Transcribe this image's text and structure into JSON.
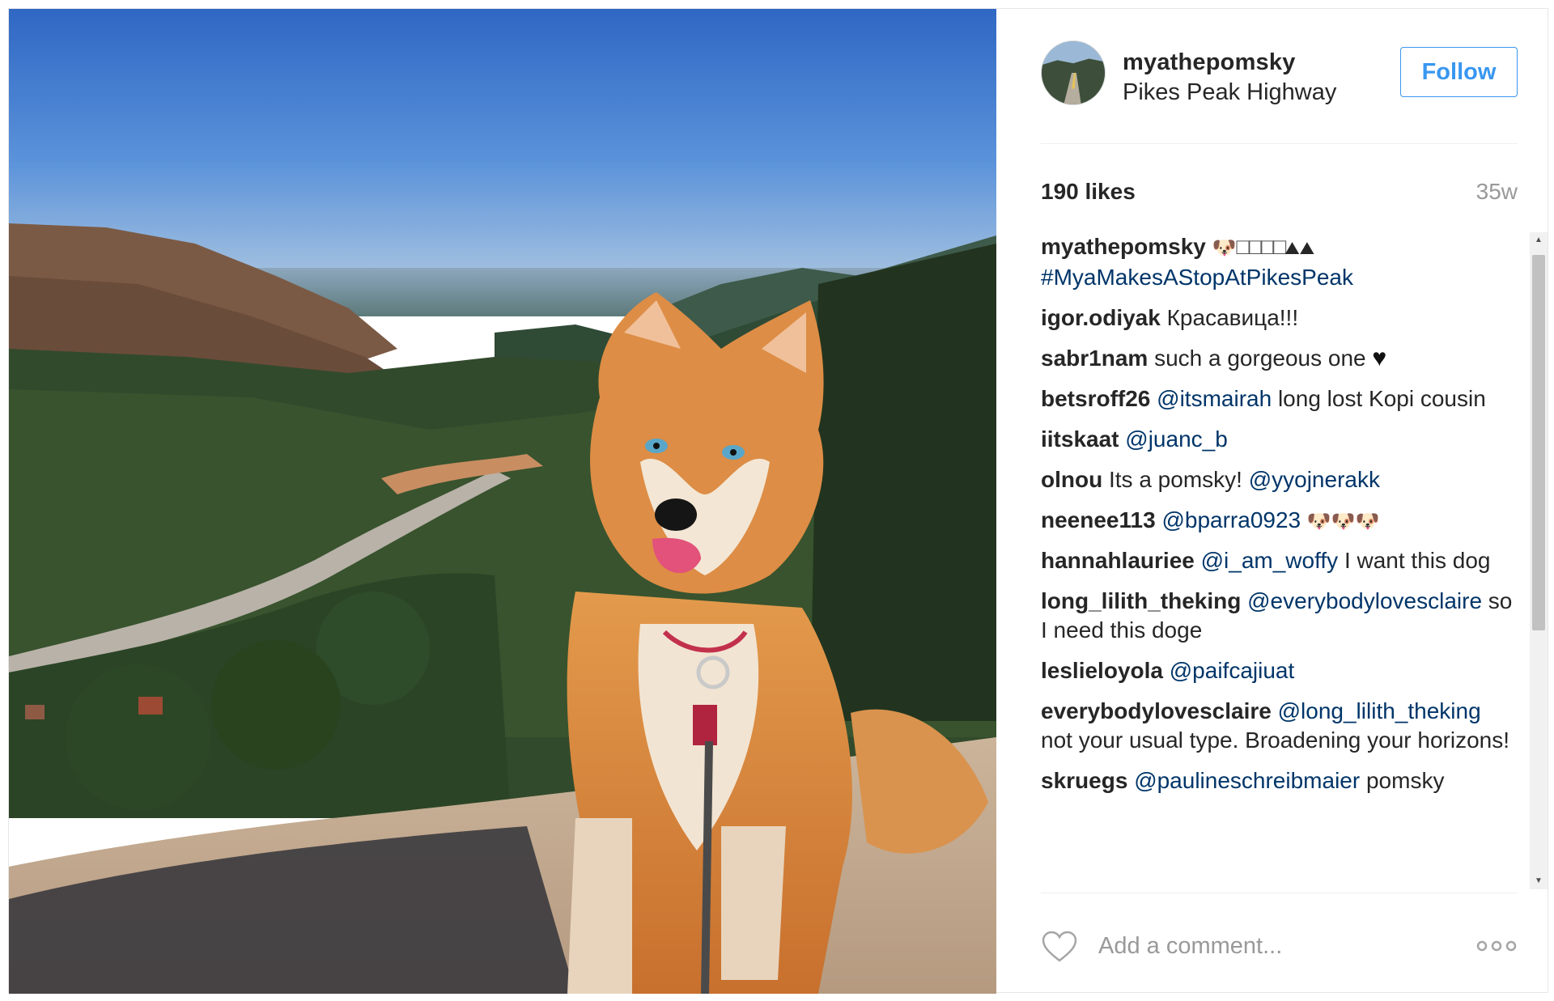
{
  "post": {
    "username": "myathepomsky",
    "location": "Pikes Peak Highway",
    "follow_label": "Follow",
    "likes": "190 likes",
    "time_ago": "35w"
  },
  "caption": {
    "user": "myathepomsky",
    "emoji": "🐶",
    "boxes": "□□□□",
    "mountains": "⛰⛰",
    "hashtag": "#MyaMakesAStopAtPikesPeak"
  },
  "comments": [
    {
      "user": "igor.odiyak",
      "mention": "",
      "text": "Красавица!!!",
      "emoji": ""
    },
    {
      "user": "sabr1nam",
      "mention": "",
      "text": "such a gorgeous one",
      "emoji": "♥"
    },
    {
      "user": "betsroff26",
      "mention": "@itsmairah",
      "text": "long lost Kopi cousin",
      "emoji": ""
    },
    {
      "user": "iitskaat",
      "mention": "@juanc_b",
      "text": "",
      "emoji": ""
    },
    {
      "user": "olnou",
      "mention": "",
      "text": "Its a pomsky!",
      "mention2": "@yyojnerakk",
      "emoji": ""
    },
    {
      "user": "neenee113",
      "mention": "@bparra0923",
      "text": "",
      "emoji": "🐶🐶🐶"
    },
    {
      "user": "hannahlauriee",
      "mention": "@i_am_woffy",
      "text": "I want this dog",
      "emoji": ""
    },
    {
      "user": "long_lilith_theking",
      "mention": "@everybodylovesclaire",
      "text": "so I need this doge",
      "emoji": ""
    },
    {
      "user": "leslieloyola",
      "mention": "@paifcajiuat",
      "text": "",
      "emoji": ""
    },
    {
      "user": "everybodylovesclaire",
      "mention": "@long_lilith_theking",
      "text": "not your usual type. Broadening your horizons!",
      "emoji": ""
    },
    {
      "user": "skruegs",
      "mention": "@paulineschreibmaier",
      "text": "pomsky",
      "emoji": ""
    }
  ],
  "footer": {
    "comment_placeholder": "Add a comment...",
    "heart_icon": "heart-outline-icon",
    "more_icon": "more-horizontal-icon"
  },
  "colors": {
    "accent": "#3897f0",
    "mention": "#003569",
    "text": "#262626",
    "muted": "#999999"
  }
}
